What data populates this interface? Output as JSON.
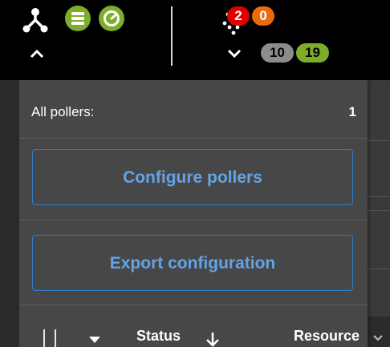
{
  "header": {
    "pollers_icon": "poller-topology-icon",
    "database_icon": "database-status-icon",
    "latency_icon": "latency-gauge-icon",
    "pollers_toggle_icon": "chevron-up-icon",
    "services_icon": "services-grid-icon",
    "services_toggle_icon": "chevron-down-icon",
    "status_badges": {
      "critical": "2",
      "warning": "0",
      "unknown": "10",
      "ok": "19"
    },
    "colors": {
      "critical": "#e00000",
      "warning": "#ea6b0c",
      "unknown": "#8c8c8c",
      "ok": "#7dad2a"
    }
  },
  "pollers_panel": {
    "title": "All pollers:",
    "count": "1",
    "configure_label": "Configure pollers",
    "export_label": "Export configuration",
    "button_color": "#63a3e6"
  },
  "table": {
    "status_label": "Status",
    "resource_label": "Resource",
    "sort_icon": "arrow-down-icon",
    "select_icon": "chevron-down-icon"
  }
}
